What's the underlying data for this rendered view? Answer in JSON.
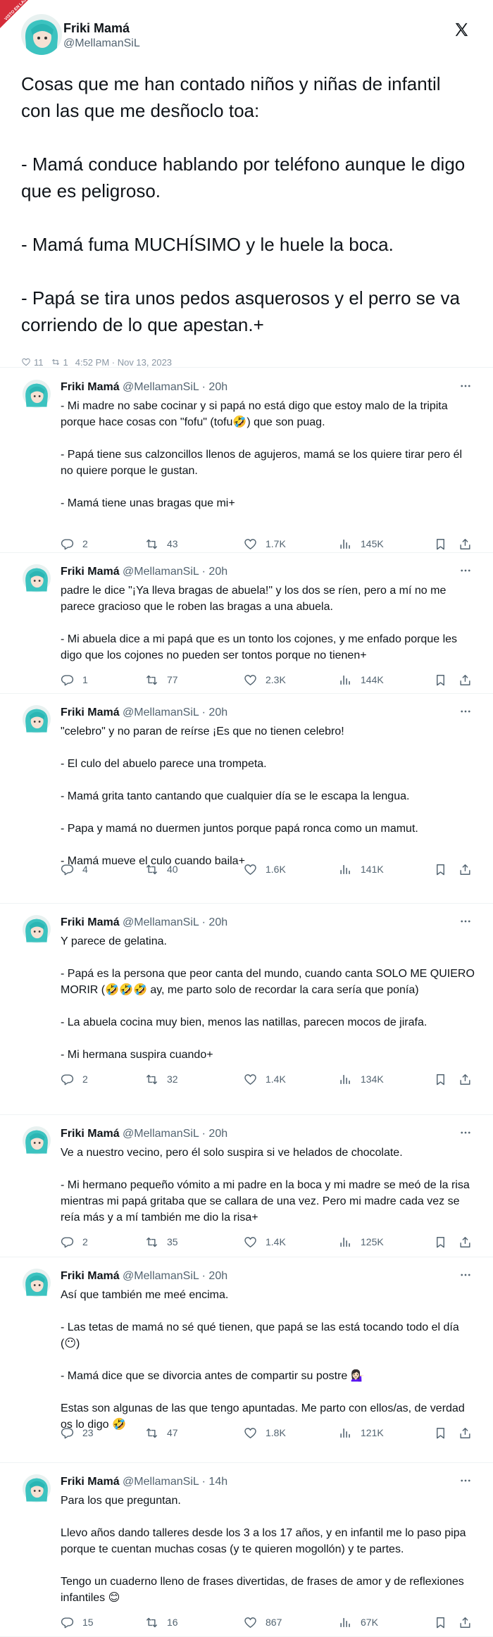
{
  "watermark": {
    "text": "VISTO EN LAS REDES .com"
  },
  "main_tweet": {
    "author_name": "Friki Mamá",
    "author_handle": "@MellamanSiL",
    "text": "Cosas que me han contado niños y niñas de infantil con las que me desñoclo toa:\n\n- Mamá conduce hablando por teléfono aunque le digo que es peligroso.\n\n- Mamá fuma MUCHÍSIMO y le huele la boca.\n\n- Papá se tira unos pedos asquerosos y el perro se va corriendo de lo que apestan.+",
    "likes": "11",
    "retweets": "1",
    "timestamp": "4:52 PM · Nov 13, 2023"
  },
  "replies": [
    {
      "name": "Friki Mamá",
      "handle": "@MellamanSiL",
      "time": "· 20h",
      "text": "- Mi madre no sabe cocinar y si papá no está digo que estoy malo de la tripita porque hace cosas con \"fofu\" (tofu🤣) que son puag.\n\n- Papá tiene sus calzoncillos llenos de agujeros, mamá se los quiere tirar pero él no quiere porque le gustan.\n\n- Mamá tiene unas bragas que mi+",
      "replies": "2",
      "retweets": "43",
      "likes": "1.7K",
      "views": "145K"
    },
    {
      "name": "Friki Mamá",
      "handle": "@MellamanSiL",
      "time": "· 20h",
      "text": "padre le dice \"¡Ya lleva bragas de abuela!\" y los dos se ríen, pero a mí no me parece gracioso que le roben las bragas a una abuela.\n\n- Mi abuela dice a mi papá que es un tonto los cojones, y me enfado porque les digo que los cojones no pueden ser tontos porque no tienen+",
      "replies": "1",
      "retweets": "77",
      "likes": "2.3K",
      "views": "144K"
    },
    {
      "name": "Friki Mamá",
      "handle": "@MellamanSiL",
      "time": "· 20h",
      "text": "\"celebro\" y no paran de reírse ¡Es que no tienen celebro!\n\n- El culo del abuelo parece una trompeta.\n\n- Mamá grita tanto cantando que cualquier día se le escapa la lengua.\n\n- Papa y mamá no duermen juntos porque papá ronca como un mamut.\n\n- Mamá mueve el culo cuando baila+",
      "replies": "4",
      "retweets": "40",
      "likes": "1.6K",
      "views": "141K"
    },
    {
      "name": "Friki Mamá",
      "handle": "@MellamanSiL",
      "time": "· 20h",
      "text": "Y parece de gelatina.\n\n- Papá es la persona que peor canta del mundo, cuando canta SOLO ME QUIERO MORIR (🤣🤣🤣 ay, me parto solo de recordar la cara sería que ponía)\n\n- La abuela cocina muy bien, menos las natillas, parecen mocos de jirafa.\n\n- Mi hermana suspira cuando+",
      "replies": "2",
      "retweets": "32",
      "likes": "1.4K",
      "views": "134K"
    },
    {
      "name": "Friki Mamá",
      "handle": "@MellamanSiL",
      "time": "· 20h",
      "text": "Ve a nuestro vecino, pero él solo suspira si ve helados de chocolate.\n\n- Mi hermano pequeño vómito a mi padre en la boca y mi madre se meó de la risa mientras mi papá gritaba que se callara de una vez. Pero mi madre cada vez se reía más y a mí también me dio la risa+",
      "replies": "2",
      "retweets": "35",
      "likes": "1.4K",
      "views": "125K"
    },
    {
      "name": "Friki Mamá",
      "handle": "@MellamanSiL",
      "time": "· 20h",
      "text": "Así que también me meé encima.\n\n- Las tetas de mamá no sé qué tienen, que papá se las está tocando todo el día (😶)\n\n- Mamá dice que se divorcia antes de compartir su postre 💁🏻‍♀️\n\nEstas son algunas de las que tengo apuntadas. Me parto con ellos/as, de verdad os lo digo 🤣",
      "replies": "23",
      "retweets": "47",
      "likes": "1.8K",
      "views": "121K"
    },
    {
      "name": "Friki Mamá",
      "handle": "@MellamanSiL",
      "time": "· 14h",
      "text": "Para los que preguntan.\n\nLlevo años dando talleres desde los 3 a los 17 años, y en infantil me lo paso pipa porque te cuentan muchas cosas (y te quieren mogollón) y te partes.\n\nTengo un cuaderno lleno de frases divertidas, de frases de amor y de reflexiones infantiles 😊",
      "replies": "15",
      "retweets": "16",
      "likes": "867",
      "views": "67K"
    }
  ]
}
